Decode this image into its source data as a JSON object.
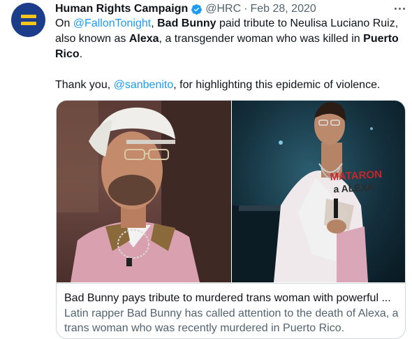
{
  "tweet": {
    "name": "Human Rights Campaign",
    "handle": "@HRC",
    "separator": "·",
    "date": "Feb 28, 2020",
    "text": {
      "p1_a": "On ",
      "p1_mention": "@FallonTonight",
      "p1_b": ", ",
      "p1_bold1": "Bad Bunny",
      "p1_c": " paid tribute to Neulisa Luciano Ruiz, also known as ",
      "p1_bold2": "Alexa",
      "p1_d": ", a transgender woman who was killed in ",
      "p1_bold3": "Puerto Rico",
      "p1_e": ".",
      "p2_a": "Thank you, ",
      "p2_mention": "@sanbenito",
      "p2_b": ", for highlighting this epidemic of violence."
    },
    "card": {
      "title": "Bad Bunny pays tribute to murdered trans woman with powerful ...",
      "description": "Latin rapper Bad Bunny has called attention to the death of Alexa, a trans woman who was recently murdered in Puerto Rico.",
      "shirt_text_line1": "MATARON",
      "shirt_text_line2": "a ALEXA"
    }
  },
  "colors": {
    "link": "#1d9bf0",
    "secondary_text": "#536471",
    "verified": "#1d9bf0",
    "avatar_bg": "#1b3d8a",
    "avatar_bars": "#f7c51c"
  },
  "icons": {
    "verified": "verified-badge-icon",
    "more": "more-options-icon"
  }
}
